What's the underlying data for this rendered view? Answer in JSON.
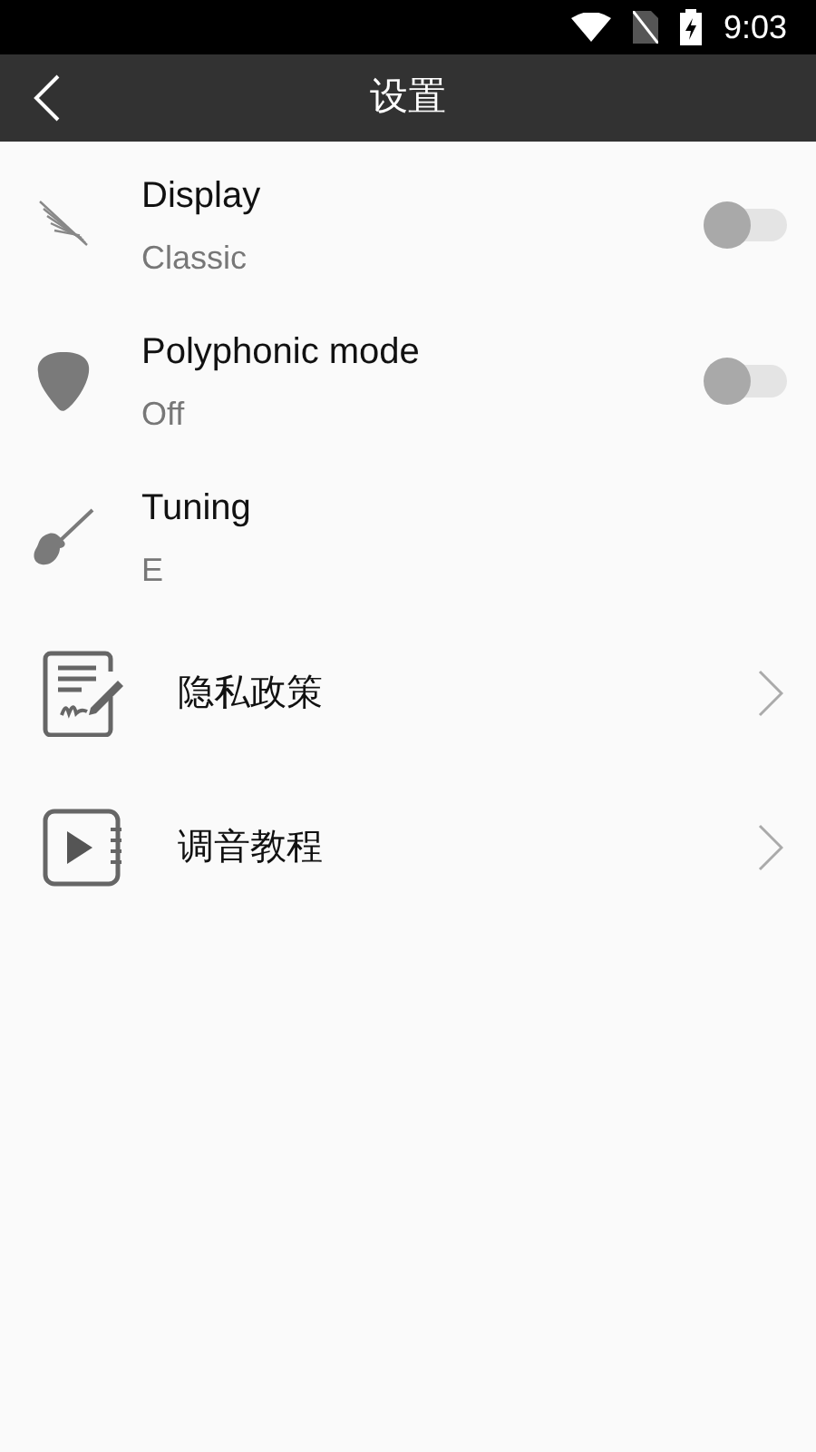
{
  "status_bar": {
    "time": "9:03"
  },
  "header": {
    "title": "设置"
  },
  "settings": [
    {
      "kind": "toggle",
      "title": "Display",
      "value": "Classic",
      "on": false
    },
    {
      "kind": "toggle",
      "title": "Polyphonic mode",
      "value": "Off",
      "on": false
    },
    {
      "kind": "value",
      "title": "Tuning",
      "value": "E"
    }
  ],
  "links": [
    {
      "kind": "link",
      "title": "隐私政策"
    },
    {
      "kind": "link",
      "title": "调音教程"
    }
  ]
}
